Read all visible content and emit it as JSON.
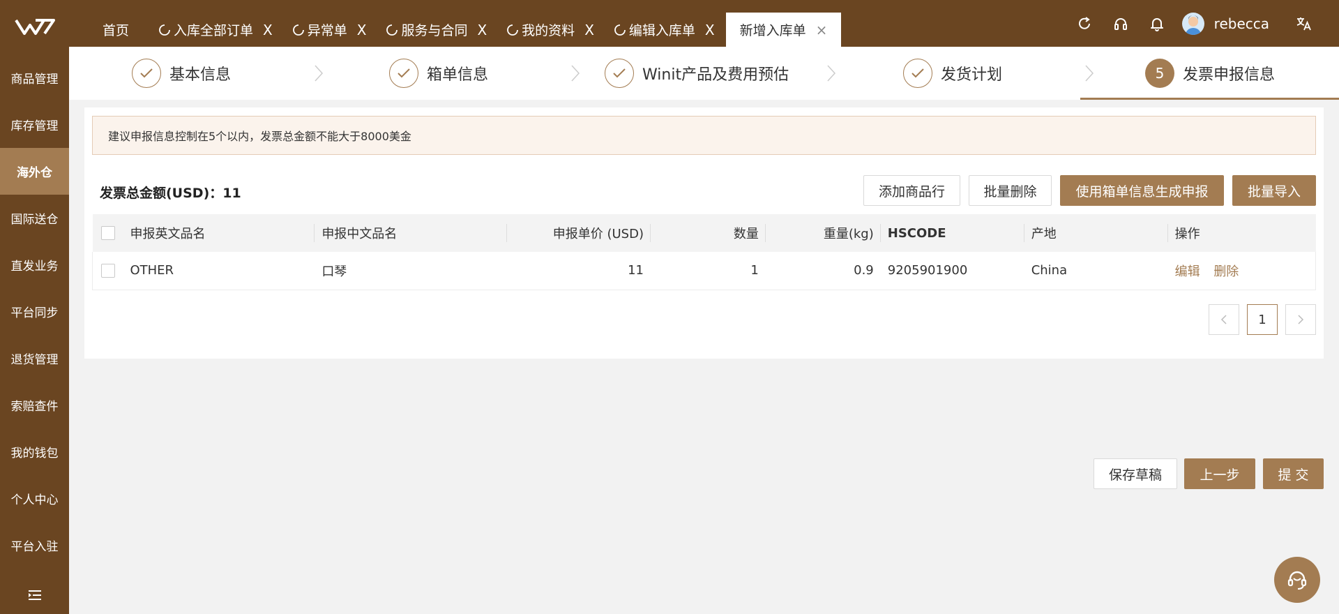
{
  "sidebar": {
    "items": [
      {
        "label": "商品管理"
      },
      {
        "label": "库存管理"
      },
      {
        "label": "海外仓",
        "active": true
      },
      {
        "label": "国际送仓"
      },
      {
        "label": "直发业务"
      },
      {
        "label": "平台同步"
      },
      {
        "label": "退货管理"
      },
      {
        "label": "索赔查件"
      },
      {
        "label": "我的钱包"
      },
      {
        "label": "个人中心"
      },
      {
        "label": "平台入驻"
      }
    ]
  },
  "tabs": [
    {
      "label": "首页"
    },
    {
      "label": "入库全部订单",
      "close": "X"
    },
    {
      "label": "异常单",
      "close": "X"
    },
    {
      "label": "服务与合同",
      "close": "X"
    },
    {
      "label": "我的资料",
      "close": "X"
    },
    {
      "label": "编辑入库单",
      "close": "X"
    },
    {
      "label": "新增入库单",
      "close": "×",
      "active": true
    }
  ],
  "user": {
    "name": "rebecca"
  },
  "steps": [
    {
      "label": "基本信息",
      "done": true
    },
    {
      "label": "箱单信息",
      "done": true
    },
    {
      "label": "Winit产品及费用预估",
      "done": true
    },
    {
      "label": "发货计划",
      "done": true
    },
    {
      "label": "发票申报信息",
      "number": "5",
      "active": true
    }
  ],
  "alert": {
    "text": "建议申报信息控制在5个以内，发票总金额不能大于8000美金"
  },
  "summary": {
    "total_label": "发票总金额(USD)：11"
  },
  "toolbar": {
    "add_row": "添加商品行",
    "batch_delete": "批量删除",
    "generate": "使用箱单信息生成申报",
    "batch_import": "批量导入"
  },
  "table": {
    "headers": {
      "en_name": "申报英文品名",
      "cn_name": "申报中文品名",
      "price": "申报单价 (USD)",
      "qty": "数量",
      "weight": "重量(kg)",
      "hscode": "HSCODE",
      "origin": "产地",
      "actions": "操作"
    },
    "rows": [
      {
        "en_name": "OTHER",
        "cn_name": "口琴",
        "price": "11",
        "qty": "1",
        "weight": "0.9",
        "hscode": "9205901900",
        "origin": "China",
        "edit": "编辑",
        "delete": "删除"
      }
    ]
  },
  "pagination": {
    "current": "1"
  },
  "footer": {
    "save_draft": "保存草稿",
    "prev": "上一步",
    "submit": "提 交"
  },
  "colors": {
    "brand": "#6a4521",
    "accent": "#a37c52",
    "alert_bg": "#fbf3ec"
  }
}
